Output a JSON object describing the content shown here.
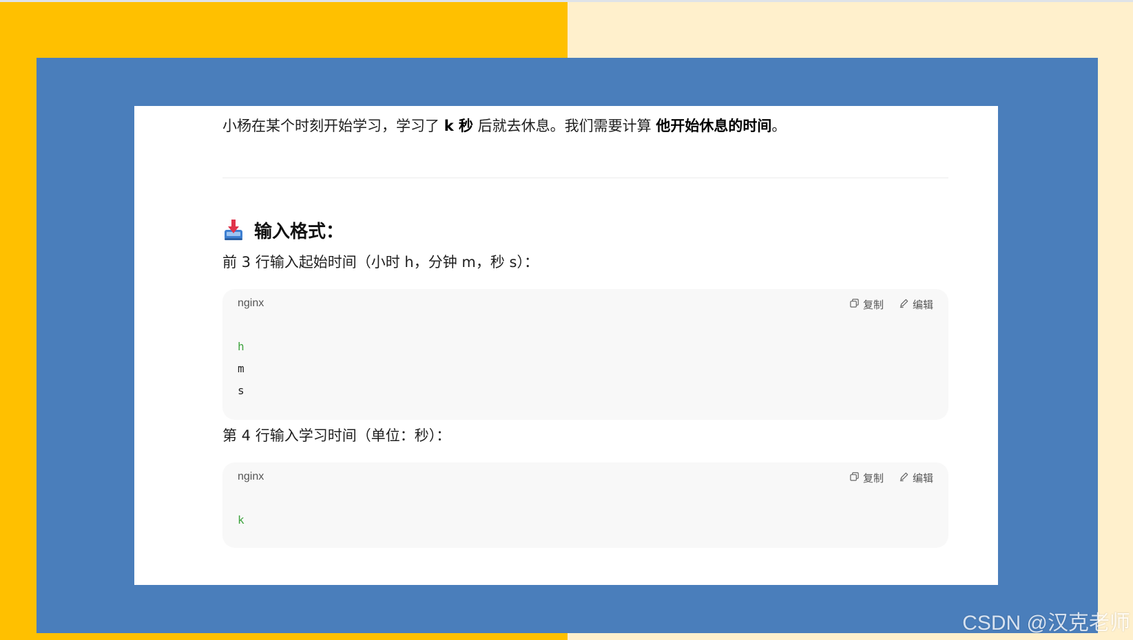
{
  "intro": {
    "part1": "小杨在某个时刻开始学习，学习了 ",
    "bold1": "k 秒",
    "part2": " 后就去休息。我们需要计算 ",
    "bold2": "他开始休息的时间",
    "part3": "。"
  },
  "section": {
    "icon": "inbox-tray-icon",
    "title": "输入格式："
  },
  "para1": "前 3 行输入起始时间（小时 h，分钟 m，秒 s）：",
  "code1": {
    "lang": "nginx",
    "copy_label": "复制",
    "edit_label": "编辑",
    "lines": [
      "h",
      "m",
      "s"
    ]
  },
  "para2": "第 4 行输入学习时间（单位：秒）：",
  "code2": {
    "lang": "nginx",
    "copy_label": "复制",
    "edit_label": "编辑",
    "lines": [
      "k"
    ]
  },
  "watermark": "CSDN @汉克老师",
  "colors": {
    "left_bg": "#FFC000",
    "right_bg": "#FFF0CC",
    "frame": "#4A7EBB",
    "code_keyword": "#3ea33e"
  }
}
